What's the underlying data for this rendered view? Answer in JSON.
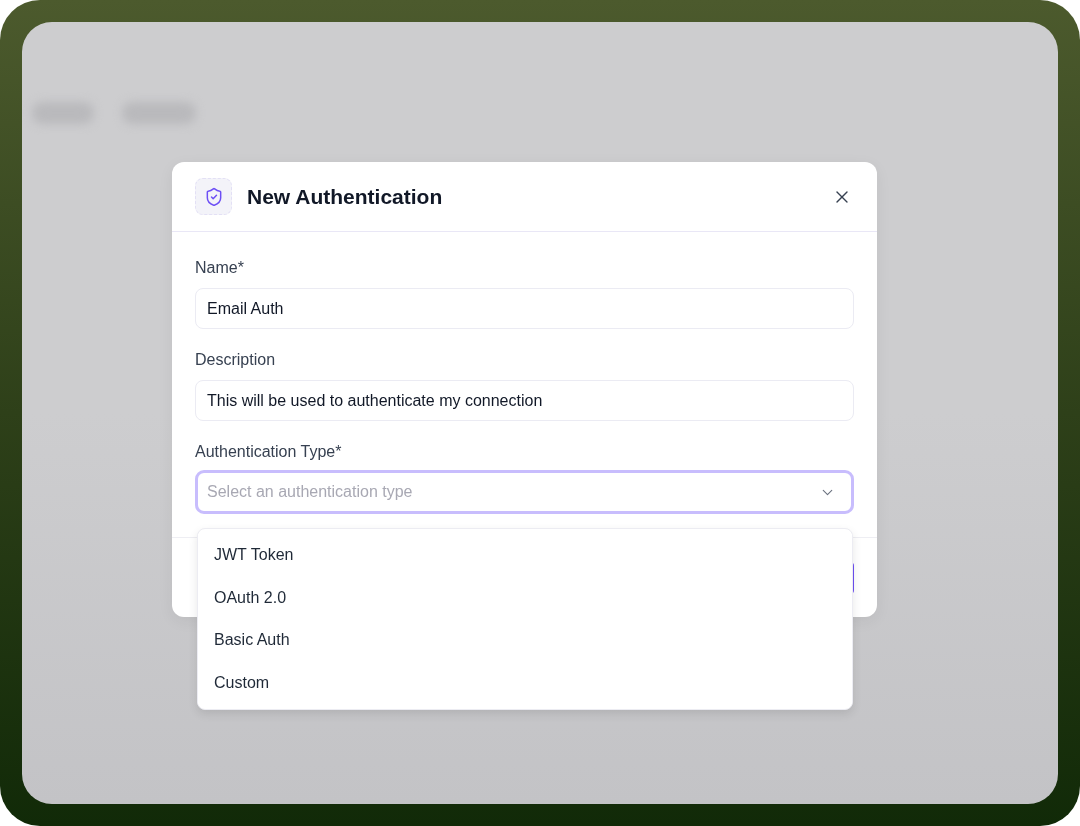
{
  "dialog": {
    "title": "New Authentication",
    "fields": [
      {
        "kind": "text",
        "label": "Name*",
        "value": "Email Auth"
      },
      {
        "kind": "text",
        "label": "Description",
        "value": "This will be used to authenticate my connection"
      },
      {
        "kind": "select",
        "label": "Authentication Type*",
        "placeholder": "Select an authentication type",
        "focused": true,
        "expanded": true,
        "options": [
          {
            "label": "JWT Token",
            "selected": false
          },
          {
            "label": "OAuth 2.0",
            "selected": false
          },
          {
            "label": "Basic Auth",
            "selected": false
          },
          {
            "label": "Custom",
            "selected": false
          }
        ]
      }
    ]
  }
}
